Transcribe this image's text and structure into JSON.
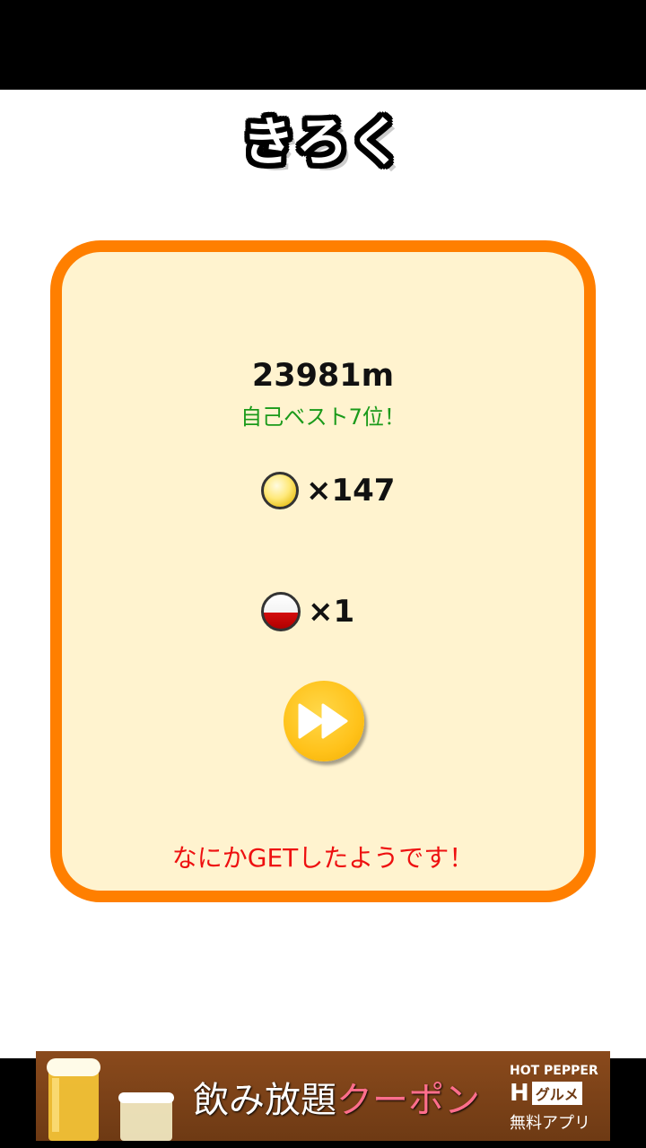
{
  "screen": {
    "title": "きろく"
  },
  "result": {
    "distance": "23981m",
    "best_rank": "自己ベスト7位！",
    "coins": "×147",
    "capsules": "×1",
    "got_message": "なにかGETしたようです！"
  },
  "icons": {
    "coin": "coin-icon",
    "capsule": "capsule-icon",
    "next": "fast-forward-icon"
  },
  "colors": {
    "panel_border": "#ff7f00",
    "panel_bg": "#fff3cf",
    "best_text": "#1a9a1a",
    "got_text": "#ee1010",
    "button": "#ffc21a"
  },
  "ad": {
    "main_text_1": "飲み放題",
    "main_text_2": "クーポン",
    "brand_top": "HOT PEPPER",
    "brand_h": "H",
    "brand_gourmet": "グルメ",
    "brand_bottom": "無料アプリ"
  }
}
